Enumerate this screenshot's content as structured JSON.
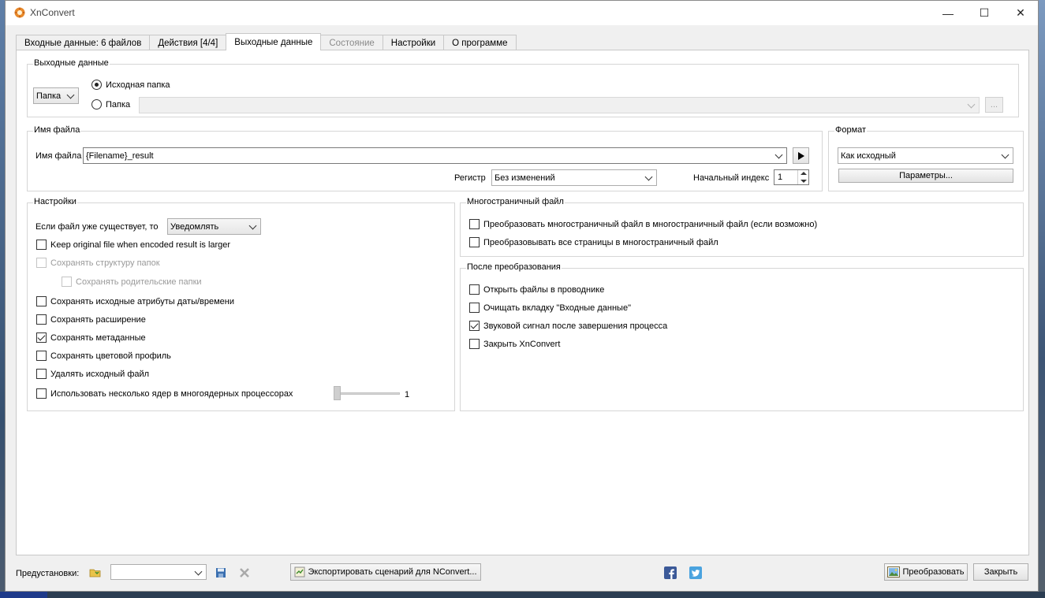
{
  "window": {
    "title": "XnConvert",
    "minimize": "—",
    "maximize": "☐",
    "close": "✕"
  },
  "tabs": [
    {
      "label": "Входные данные: 6 файлов"
    },
    {
      "label": "Действия [4/4]"
    },
    {
      "label": "Выходные данные"
    },
    {
      "label": "Состояние"
    },
    {
      "label": "Настройки"
    },
    {
      "label": "О программе"
    }
  ],
  "output": {
    "group_title": "Выходные данные",
    "folder_mode": "Папка",
    "radio_source": "Исходная папка",
    "radio_folder": "Папка",
    "folder_path": "",
    "browse_label": "..."
  },
  "filename": {
    "group_title": "Имя файла",
    "label": "Имя файла",
    "value": "{Filename}_result",
    "case_label": "Регистр",
    "case_value": "Без изменений",
    "start_index_label": "Начальный индекс",
    "start_index_value": "1"
  },
  "format": {
    "group_title": "Формат",
    "value": "Как исходный",
    "params_button": "Параметры..."
  },
  "settings": {
    "group_title": "Настройки",
    "exists_label": "Если файл уже существует, то",
    "exists_value": "Уведомлять",
    "options": [
      {
        "label": "Keep original file when encoded result is larger",
        "checked": false
      },
      {
        "label": "Сохранять структуру папок",
        "checked": false
      },
      {
        "label": "Сохранять родительские папки",
        "checked": false
      },
      {
        "label": "Сохранять исходные атрибуты даты/времени",
        "checked": false
      },
      {
        "label": "Сохранять расширение",
        "checked": false
      },
      {
        "label": "Сохранять метаданные",
        "checked": true
      },
      {
        "label": "Сохранять цветовой профиль",
        "checked": false
      },
      {
        "label": "Удалять исходный файл",
        "checked": false
      },
      {
        "label": "Использовать несколько ядер в многоядерных процессорах",
        "checked": false
      }
    ],
    "cores_value": "1"
  },
  "multipage": {
    "group_title": "Многостраничный файл",
    "options": [
      {
        "label": "Преобразовать многостраничный файл в многостраничный файл (если возможно)",
        "checked": false
      },
      {
        "label": "Преобразовывать все страницы в многостраничный файл",
        "checked": false
      }
    ]
  },
  "after": {
    "group_title": "После преобразования",
    "options": [
      {
        "label": "Открыть файлы в проводнике",
        "checked": false
      },
      {
        "label": "Очищать вкладку \"Входные данные\"",
        "checked": false
      },
      {
        "label": "Звуковой сигнал после завершения процесса",
        "checked": true
      },
      {
        "label": "Закрыть XnConvert",
        "checked": false
      }
    ]
  },
  "bottom": {
    "presets_label": "Предустановки:",
    "preset_value": "",
    "export_button": "Экспортировать сценарий для NConvert...",
    "convert_button": "Преобразовать",
    "close_button": "Закрыть"
  }
}
